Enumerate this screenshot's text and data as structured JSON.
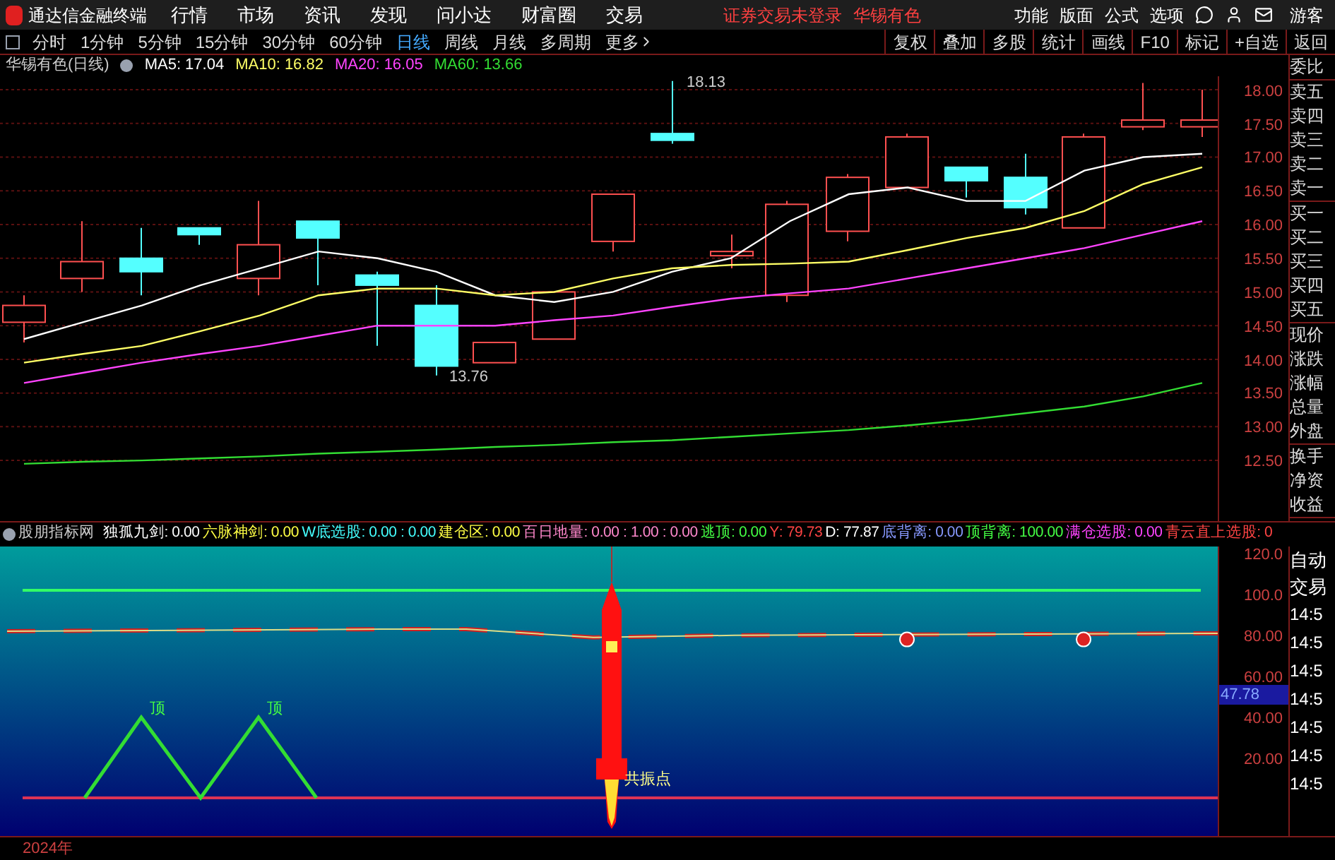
{
  "app_bar": {
    "title": "通达信金融终端",
    "menus": [
      "行情",
      "市场",
      "资讯",
      "发现",
      "问小达",
      "财富圈",
      "交易"
    ],
    "notices": [
      "证券交易未登录",
      "华锡有色"
    ],
    "actions": [
      "功能",
      "版面",
      "公式",
      "选项"
    ],
    "user": "游客"
  },
  "period_tabs": [
    {
      "label": "分时",
      "selected": false
    },
    {
      "label": "1分钟",
      "selected": false
    },
    {
      "label": "5分钟",
      "selected": false
    },
    {
      "label": "15分钟",
      "selected": false
    },
    {
      "label": "30分钟",
      "selected": false
    },
    {
      "label": "60分钟",
      "selected": false
    },
    {
      "label": "日线",
      "selected": true
    },
    {
      "label": "周线",
      "selected": false
    },
    {
      "label": "月线",
      "selected": false
    },
    {
      "label": "多周期",
      "selected": false
    }
  ],
  "more": "更多",
  "tools": [
    "复权",
    "叠加",
    "多股",
    "统计",
    "画线",
    "F10",
    "标记",
    "+自选",
    "返回"
  ],
  "chart": {
    "title": "华锡有色(日线)",
    "ma": [
      {
        "label": "MA5: 17.04"
      },
      {
        "label": "MA10: 16.82"
      },
      {
        "label": "MA20: 16.05"
      },
      {
        "label": "MA60: 13.66"
      }
    ],
    "high_label": "18.13",
    "low_label": "13.76",
    "chart_data": {
      "type": "line",
      "grid": true,
      "ylim": [
        11.6,
        18.2
      ],
      "yticks": [
        {
          "value": 18,
          "label": "18.00"
        },
        {
          "value": 17.5,
          "label": "17.50"
        },
        {
          "value": 17,
          "label": "17.00"
        },
        {
          "value": 16.5,
          "label": "16.50"
        },
        {
          "value": 16,
          "label": "16.00"
        },
        {
          "value": 15.5,
          "label": "15.50"
        },
        {
          "value": 15,
          "label": "15.00"
        },
        {
          "value": 14.5,
          "label": "14.50"
        },
        {
          "value": 14,
          "label": "14.00"
        },
        {
          "value": 13.5,
          "label": "13.50"
        },
        {
          "value": 13,
          "label": "13.00"
        },
        {
          "value": 12.5,
          "label": "12.50"
        }
      ],
      "series": [
        {
          "color": "#ffffff",
          "values": [
            14.3,
            14.55,
            14.8,
            15.1,
            15.35,
            15.6,
            15.5,
            15.3,
            14.95,
            14.85,
            15.0,
            15.3,
            15.5,
            16.05,
            16.45,
            16.55,
            16.35,
            16.35,
            16.8,
            17.0,
            17.05
          ]
        },
        {
          "color": "#ffff66",
          "values": [
            13.95,
            14.08,
            14.2,
            14.42,
            14.65,
            14.95,
            15.05,
            15.05,
            14.95,
            15.0,
            15.2,
            15.35,
            15.4,
            15.42,
            15.45,
            15.62,
            15.8,
            15.95,
            16.2,
            16.6,
            16.85
          ]
        },
        {
          "color": "#ff44ff",
          "values": [
            13.65,
            13.8,
            13.95,
            14.08,
            14.2,
            14.35,
            14.5,
            14.5,
            14.5,
            14.58,
            14.65,
            14.78,
            14.9,
            14.98,
            15.05,
            15.2,
            15.35,
            15.5,
            15.65,
            15.85,
            16.05
          ]
        },
        {
          "color": "#33dd33",
          "values": [
            12.45,
            12.48,
            12.5,
            12.53,
            12.56,
            12.6,
            12.63,
            12.66,
            12.7,
            12.73,
            12.77,
            12.8,
            12.85,
            12.9,
            12.95,
            13.02,
            13.1,
            13.2,
            13.3,
            13.45,
            13.65
          ]
        }
      ]
    }
  },
  "quote_panel": {
    "groups": [
      [
        "委比"
      ],
      [
        "卖五",
        "卖四",
        "卖三",
        "卖二",
        "卖一"
      ],
      [
        "买一",
        "买二",
        "买三",
        "买四",
        "买五"
      ],
      [
        "现价",
        "涨跌",
        "涨幅",
        "总量",
        "外盘"
      ],
      [
        "换手",
        "净资",
        "收益"
      ]
    ]
  },
  "indicator": {
    "name": "股朋指标网",
    "items": [
      {
        "label": "独孤九剑",
        "value": ": 0.00",
        "color": "#ffffff"
      },
      {
        "label": "六脉神剑",
        "value": ": 0.00",
        "color": "#ffff44"
      },
      {
        "label": "W底选股",
        "value": ": 0.00 : 0.00",
        "color": "#44ffff"
      },
      {
        "label": "建仓区",
        "value": ": 0.00",
        "color": "#ffff44"
      },
      {
        "label": "百日地量",
        "value": ": 0.00 : 1.00 : 0.00",
        "color": "#ff88cc"
      },
      {
        "label": "逃顶",
        "value": ": 0.00",
        "color": "#44ff44"
      },
      {
        "label": "Y",
        "value": ": 79.73",
        "color": "#ff4444"
      },
      {
        "label": "D",
        "value": ": 77.87",
        "color": "#ffffff"
      },
      {
        "label": "底背离",
        "value": ": 0.00",
        "color": "#8899ff"
      },
      {
        "label": "顶背离",
        "value": ": 100.00",
        "color": "#44ff44"
      },
      {
        "label": "满仓选股",
        "value": ": 0.00",
        "color": "#ff44ff"
      },
      {
        "label": "青云直上选股",
        "value": ": 0",
        "color": "#ff4444"
      }
    ],
    "y_ticks": [
      "120.0",
      "100.0",
      "80.00",
      "60.00",
      "40.00",
      "20.00"
    ],
    "current": "47.78",
    "marks": [
      "顶",
      "顶"
    ],
    "signal": "共振点"
  },
  "trade_panel": {
    "header": [
      "自动",
      "交易"
    ],
    "times": [
      "14:5",
      "14:5",
      "14:5",
      "14:5",
      "14:5",
      "14:5",
      "14:5"
    ]
  },
  "footer": {
    "year": "2024年"
  }
}
